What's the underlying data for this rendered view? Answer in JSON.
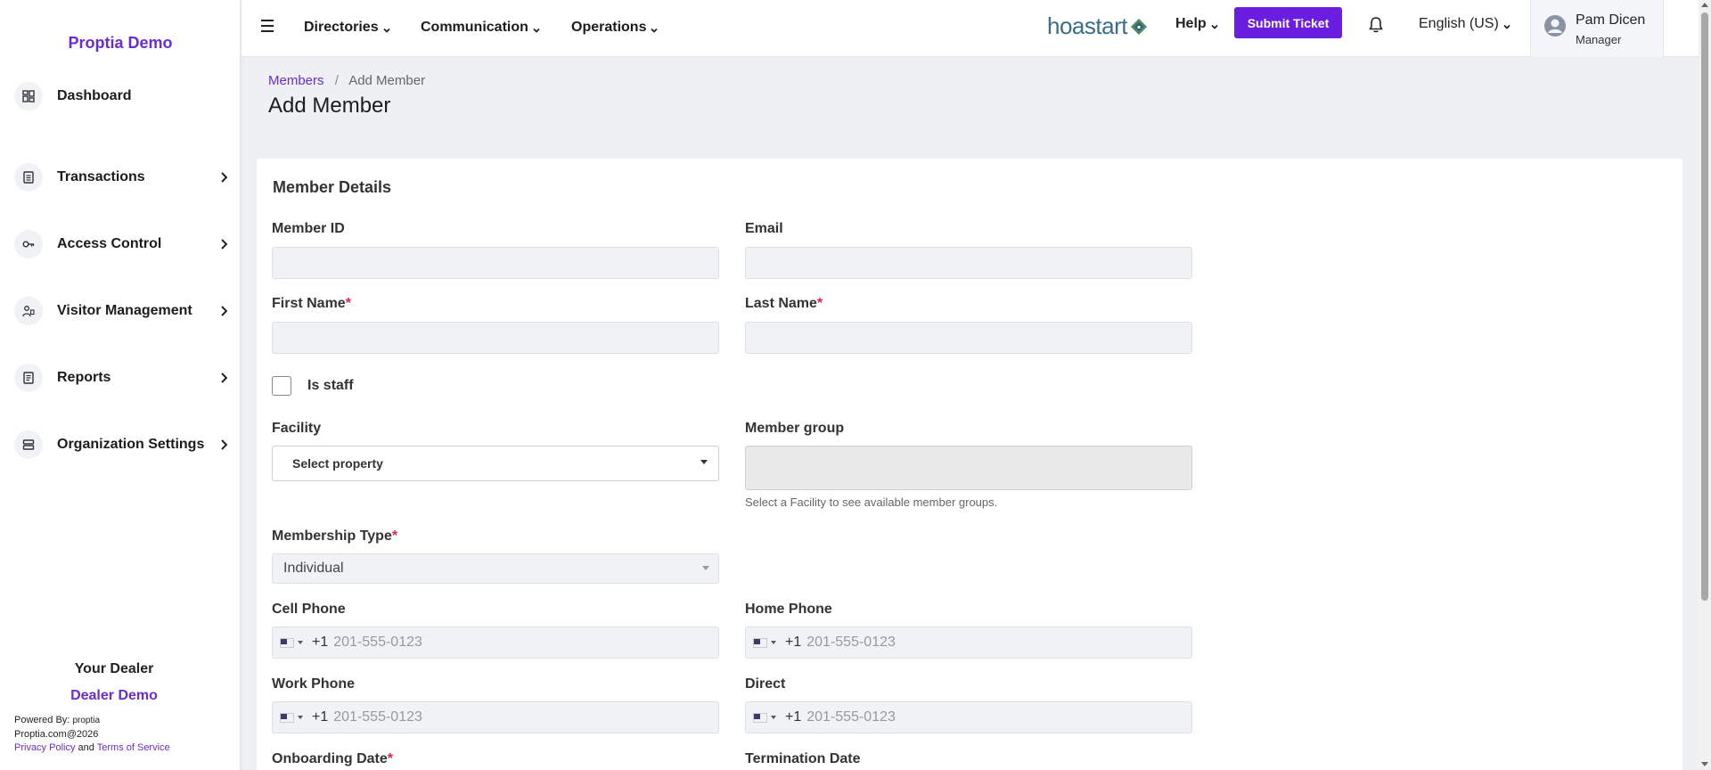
{
  "sidebar": {
    "brand": "Proptia Demo",
    "items": [
      {
        "label": "Dashboard",
        "icon": "dashboard-icon",
        "has_children": false
      },
      {
        "label": "Transactions",
        "icon": "document-icon",
        "has_children": true
      },
      {
        "label": "Access Control",
        "icon": "key-icon",
        "has_children": true
      },
      {
        "label": "Visitor Management",
        "icon": "visitor-icon",
        "has_children": true
      },
      {
        "label": "Reports",
        "icon": "report-icon",
        "has_children": true
      },
      {
        "label": "Organization Settings",
        "icon": "server-icon",
        "has_children": true
      }
    ],
    "dealer_title": "Your Dealer",
    "dealer_name": "Dealer Demo",
    "powered_by": "Powered By:",
    "powered_brand": "proptia",
    "copyright": "Proptia.com@2026",
    "privacy": "Privacy Policy",
    "and": "and",
    "terms": "Terms of Service"
  },
  "topbar": {
    "menus": [
      "Directories",
      "Communication",
      "Operations"
    ],
    "logo_text": "hoastart",
    "help": "Help",
    "submit_ticket": "Submit Ticket",
    "language": "English (US)",
    "user_name": "Pam Dicen",
    "user_role": "Manager"
  },
  "breadcrumb": {
    "parent": "Members",
    "separator": "/",
    "current": "Add Member"
  },
  "page_title": "Add Member",
  "form": {
    "section_title": "Member Details",
    "member_id": {
      "label": "Member ID",
      "value": ""
    },
    "email": {
      "label": "Email",
      "value": ""
    },
    "first_name": {
      "label": "First Name",
      "required": "*",
      "value": ""
    },
    "last_name": {
      "label": "Last Name",
      "required": "*",
      "value": ""
    },
    "is_staff": {
      "label": "Is staff",
      "checked": false
    },
    "facility": {
      "label": "Facility",
      "placeholder": "Select property"
    },
    "member_group": {
      "label": "Member group",
      "hint": "Select a Facility to see available member groups."
    },
    "membership_type": {
      "label": "Membership Type",
      "required": "*",
      "value": "Individual"
    },
    "cell_phone": {
      "label": "Cell Phone",
      "dial": "+1",
      "placeholder": "201-555-0123"
    },
    "home_phone": {
      "label": "Home Phone",
      "dial": "+1",
      "placeholder": "201-555-0123"
    },
    "work_phone": {
      "label": "Work Phone",
      "dial": "+1",
      "placeholder": "201-555-0123"
    },
    "direct": {
      "label": "Direct",
      "dial": "+1",
      "placeholder": "201-555-0123"
    },
    "onboarding_date": {
      "label": "Onboarding Date",
      "required": "*"
    },
    "termination_date": {
      "label": "Termination Date"
    }
  },
  "colors": {
    "accent": "#6a2cd8",
    "button": "#6a1ee0",
    "required": "#e0234e"
  }
}
